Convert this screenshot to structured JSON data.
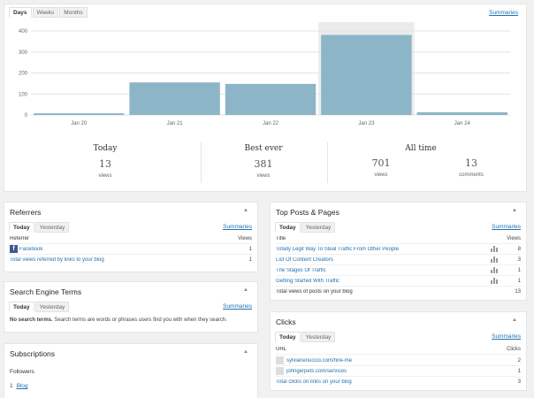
{
  "top_tabs": [
    "Days",
    "Weeks",
    "Months"
  ],
  "summaries_label": "Summaries",
  "chart_data": {
    "type": "bar",
    "categories": [
      "Jan 20",
      "Jan 21",
      "Jan 22",
      "Jan 23",
      "Jan 24"
    ],
    "values": [
      8,
      155,
      148,
      381,
      13
    ],
    "ylim": [
      0,
      400
    ],
    "yticks": [
      "0",
      "100",
      "200",
      "300",
      "400"
    ],
    "highlighted_index": 3,
    "bar_color": "#8cb5c8"
  },
  "stats": {
    "today": {
      "label": "Today",
      "value": "13",
      "unit": "views"
    },
    "best": {
      "label": "Best ever",
      "value": "381",
      "unit": "views"
    },
    "all_time": {
      "label": "All time",
      "views_value": "701",
      "views_unit": "views",
      "comments_value": "13",
      "comments_unit": "comments"
    }
  },
  "referrers": {
    "title": "Referrers",
    "tabs": [
      "Today",
      "Yesterday"
    ],
    "col_left": "Referrer",
    "col_right": "Views",
    "rows": [
      {
        "label": "Facebook",
        "views": "1",
        "icon": "facebook-icon"
      }
    ],
    "total_label": "Total views referred by links to your blog",
    "total_value": "1"
  },
  "search_terms": {
    "title": "Search Engine Terms",
    "tabs": [
      "Today",
      "Yesterday"
    ],
    "empty_bold": "No search terms.",
    "empty_text": " Search terms are words or phrases users find you with when they search."
  },
  "subscriptions": {
    "title": "Subscriptions",
    "followers_label": "Followers",
    "count": "1",
    "link": "Blog"
  },
  "top_posts": {
    "title": "Top Posts & Pages",
    "tabs": [
      "Today",
      "Yesterday"
    ],
    "col_left": "Title",
    "col_right": "Views",
    "rows": [
      {
        "label": "Totally Legit Way To Steal Traffic From Other People",
        "views": "8"
      },
      {
        "label": "List Of Content Creators",
        "views": "3"
      },
      {
        "label": "The Stages Of Traffic",
        "views": "1"
      },
      {
        "label": "Getting Started With Traffic",
        "views": "1"
      }
    ],
    "total_label": "Total views of posts on your blog",
    "total_value": "13"
  },
  "clicks": {
    "title": "Clicks",
    "tabs": [
      "Today",
      "Yesterday"
    ],
    "col_left": "URL",
    "col_right": "Clicks",
    "rows": [
      {
        "label": "sylvianenuccio.com/hire-me",
        "clicks": "2"
      },
      {
        "label": "johngerpets.com/services",
        "clicks": "1"
      }
    ],
    "total_label": "Total clicks on links on your blog",
    "total_value": "3"
  }
}
